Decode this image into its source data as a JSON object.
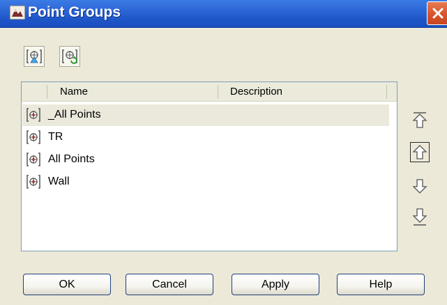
{
  "window": {
    "title": "Point Groups",
    "close_glyph": "✕"
  },
  "toolbar": {
    "buttons": [
      {
        "name": "point-group-properties-icon"
      },
      {
        "name": "point-group-update-icon"
      }
    ]
  },
  "list": {
    "columns": [
      "Name",
      "Description"
    ],
    "rows": [
      {
        "name": "_All Points",
        "description": "",
        "selected": true
      },
      {
        "name": "TR",
        "description": "",
        "selected": false
      },
      {
        "name": "All Points",
        "description": "",
        "selected": false
      },
      {
        "name": "Wall",
        "description": "",
        "selected": false
      }
    ]
  },
  "order_buttons": [
    {
      "name": "move-to-top-icon"
    },
    {
      "name": "move-up-icon"
    },
    {
      "name": "move-down-icon"
    },
    {
      "name": "move-to-bottom-icon"
    }
  ],
  "buttons": {
    "ok": "OK",
    "cancel": "Cancel",
    "apply": "Apply",
    "help": "Help"
  },
  "colors": {
    "titlebar": "#2a63d4",
    "close": "#d7542c",
    "dialog_bg": "#ece9d8",
    "selection": "#ebe9dc"
  }
}
